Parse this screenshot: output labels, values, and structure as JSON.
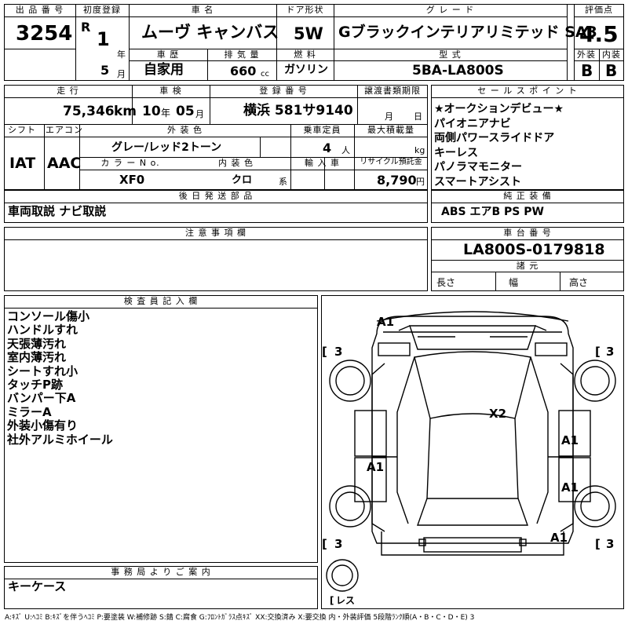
{
  "header": {
    "lot_label": "出 品 番 号",
    "lot_number": "3254",
    "first_reg_label": "初度登録",
    "era": "R",
    "first_reg_year": "1",
    "year_unit": "年",
    "first_reg_month": "5",
    "month_unit": "月",
    "car_name_label": "車 名",
    "car_name": "ムーヴ キャンバス",
    "door_label": "ドア形状",
    "door": "5W",
    "grade_label": "グ レ ー ド",
    "grade": "Gブラックインテリアリミテッド SA3",
    "score_label": "評価点",
    "score": "4.5",
    "history_label": "車 歴",
    "history": "自家用",
    "displacement_label": "排 気 量",
    "displacement": "660",
    "displacement_unit": "cc",
    "fuel_label": "燃 料",
    "fuel": "ガソリン",
    "model_label": "型 式",
    "model": "5BA-LA800S",
    "exterior_label": "外装",
    "exterior_grade": "B",
    "interior_label": "内装",
    "interior_grade": "B"
  },
  "details": {
    "mileage_label": "走 行",
    "mileage": "75,346",
    "mileage_unit": "km",
    "inspection_label": "車 検",
    "inspection_year": "10",
    "inspection_year_unit": "年",
    "inspection_month": "05",
    "inspection_month_unit": "月",
    "plate_label": "登 録 番 号",
    "plate": "横浜 581サ9140",
    "transfer_label": "譲渡書類期限",
    "transfer_month_unit": "月",
    "transfer_day_unit": "日",
    "shift_label": "シフト",
    "shift": "IAT",
    "ac_label": "エアコン",
    "ac": "AAC",
    "color_label": "外 装 色",
    "color": "グレー/レッド2トーン",
    "capacity_label": "乗車定員",
    "capacity": "4",
    "capacity_unit": "人",
    "load_label": "最大積載量",
    "load_unit": "kg",
    "color_no_label": "カ ラ ー N o.",
    "color_no": "XF0",
    "interior_color_label": "内 装 色",
    "interior_color": "クロ",
    "interior_color_unit": "系",
    "import_label": "輸 入 車",
    "recycle_label": "リサイクル預託金",
    "recycle": "8,790",
    "recycle_unit": "円"
  },
  "sales_points": {
    "label": "セ ー ル ス ポ イ ン ト",
    "items": [
      "★オークションデビュー★",
      "パイオニアナビ",
      "両側パワースライドドア",
      "キーレス",
      "パノラマモニター",
      "スマートアシスト"
    ]
  },
  "later_parts": {
    "label": "後 日 発 送 部 品",
    "text": "車両取説 ナビ取説"
  },
  "genuine_equipment": {
    "label": "純 正 装 備",
    "text": "ABS エアB PS PW"
  },
  "caution": {
    "label": "注 意 事 項 欄"
  },
  "chassis": {
    "label": "車 台 番 号",
    "number": "LA800S-0179818",
    "specs_label": "諸 元",
    "length_label": "長さ",
    "width_label": "幅",
    "height_label": "高さ"
  },
  "inspector": {
    "label": "検 査 員 記 入 欄",
    "lines": [
      "コンソール傷小",
      "ハンドルすれ",
      "天張薄汚れ",
      "室内薄汚れ",
      "シートすれ小",
      "タッチP跡",
      "バンパー下A",
      "ミラーA",
      "外装小傷有り",
      "社外アルミホイール"
    ]
  },
  "office": {
    "label": "事 務 局 よ り ご 案 内",
    "text": "キーケース"
  },
  "diagram": {
    "marks": [
      "A1",
      "X2",
      "A1",
      "A1",
      "A1",
      "A1"
    ],
    "tires": [
      "3",
      "3",
      "3",
      "3"
    ],
    "spare": "レス"
  },
  "legend": "A:ｷｽﾞ U:ﾍｺﾐ B:ｷｽﾞを伴うﾍｺﾐ P:要塗装 W:補修跡 S:錆 C:腐食 G:ﾌﾛﾝﾄｶﾞﾗｽ点ｷｽﾞ XX:交換済み X:要交換 内・外装評価 5段階ﾗﾝｸ順(A・B・C・D・E) 3"
}
